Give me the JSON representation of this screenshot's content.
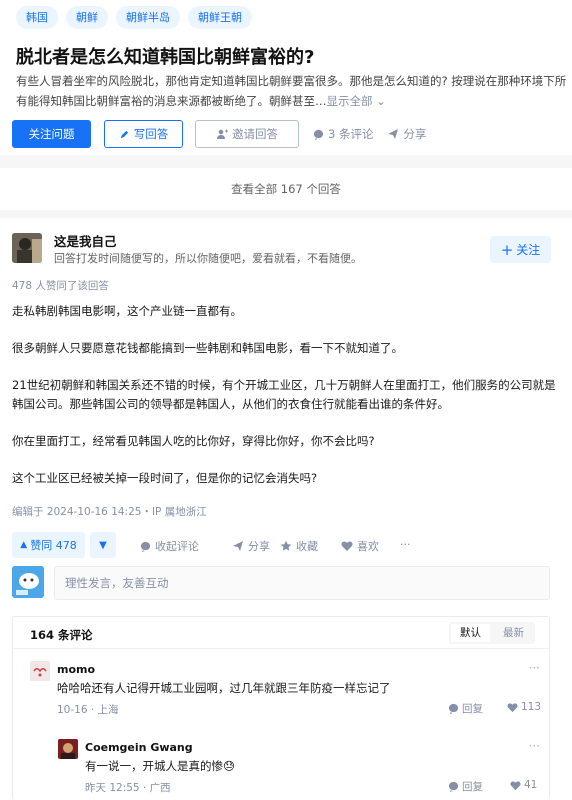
{
  "question": {
    "tags": [
      "韩国",
      "朝鲜",
      "朝鲜半岛",
      "朝鲜王朝"
    ],
    "title": "脱北者是怎么知道韩国比朝鲜富裕的?",
    "description": "有些人冒着坐牢的风险脱北，那他肯定知道韩国比朝鲜要富很多。那他是怎么知道的? 按理说在那种环境下所有能得知韩国比朝鲜富裕的消息来源都被断绝了。朝鲜甚至…",
    "show_all": "显示全部",
    "actions": {
      "follow": "关注问题",
      "write": "写回答",
      "invite": "邀请回答",
      "comments": "3 条评论",
      "share": "分享"
    }
  },
  "view_all": "查看全部 167 个回答",
  "answer": {
    "author": "这是我自己",
    "bio": "回答打发时间随便写的，所以你随便吧，爱看就看，不看随便。",
    "follow_label": "关注",
    "votes_summary": "478 人赞同了该回答",
    "paragraphs": [
      "走私韩剧韩国电影啊，这个产业链一直都有。",
      "很多朝鲜人只要愿意花钱都能搞到一些韩剧和韩国电影，看一下不就知道了。",
      "21世纪初朝鲜和韩国关系还不错的时候，有个开城工业区，几十万朝鲜人在里面打工，他们服务的公司就是韩国公司。那些韩国公司的领导都是韩国人，从他们的衣食住行就能看出谁的条件好。",
      "你在里面打工，经常看见韩国人吃的比你好，穿得比你好，你不会比吗?",
      "这个工业区已经被关掉一段时间了，但是你的记忆会消失吗?"
    ],
    "edited": "编辑于 2024-10-16 14:25・IP 属地浙江",
    "vote_up": "赞同 478",
    "actions": {
      "collapse_comments": "收起评论",
      "share": "分享",
      "favorite": "收藏",
      "like": "喜欢",
      "more": "···"
    }
  },
  "comment_box": {
    "placeholder": "理性发言，友善互动"
  },
  "comments": {
    "count": "164 条评论",
    "sort_default": "默认",
    "sort_latest": "最新",
    "items": [
      {
        "name": "momo",
        "text": "哈哈哈还有人记得开城工业园啊，过几年就跟三年防疫一样忘记了",
        "date": "10-16",
        "location": "上海",
        "reply": "回复",
        "likes": "113"
      },
      {
        "name": "Coemgein Gwang",
        "text": "有一说一，开城人是真的惨😓",
        "date": "昨天 12:55",
        "location": "广西",
        "reply": "回复",
        "likes": "41"
      }
    ]
  },
  "colors": {
    "brand": "#1772f6",
    "brand_light": "#ebf5ff",
    "muted": "#8590a6"
  }
}
